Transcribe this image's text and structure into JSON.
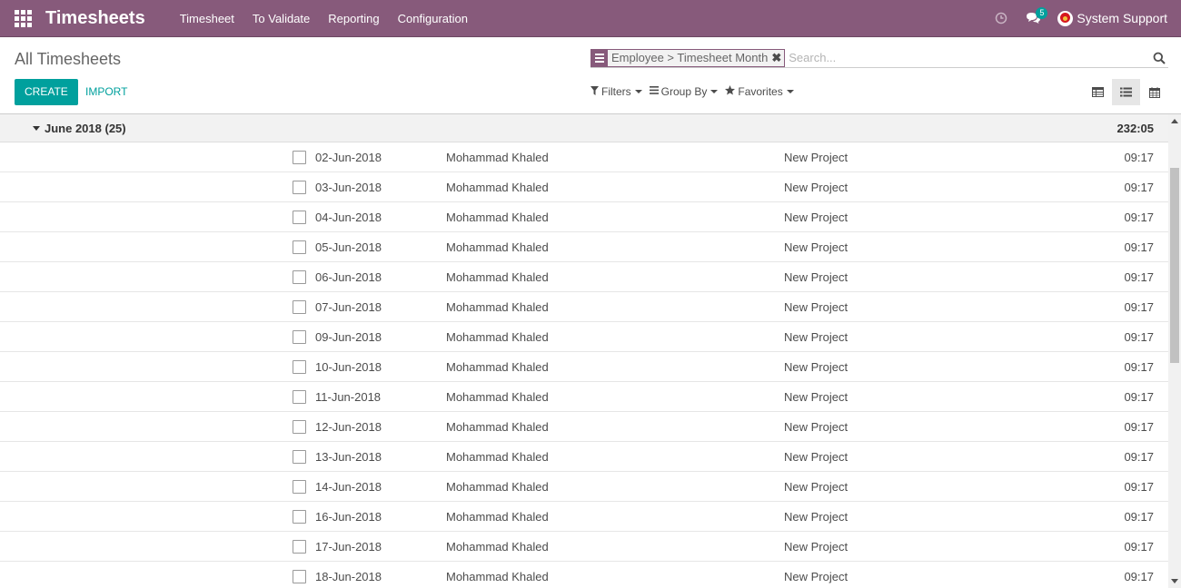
{
  "navbar": {
    "brand": "Timesheets",
    "menu": [
      "Timesheet",
      "To Validate",
      "Reporting",
      "Configuration"
    ],
    "message_count": "5",
    "user_name": "System Support"
  },
  "control_panel": {
    "breadcrumb": "All Timesheets",
    "create_label": "CREATE",
    "import_label": "IMPORT",
    "facet_label": "Employee > Timesheet Month",
    "search_placeholder": "Search...",
    "filters_label": "Filters",
    "group_by_label": "Group By",
    "favorites_label": "Favorites"
  },
  "group": {
    "label": "June 2018 (25)",
    "total": "232:05"
  },
  "rows": [
    {
      "date": "02-Jun-2018",
      "employee": "Mohammad Khaled",
      "project": "New Project",
      "duration": "09:17"
    },
    {
      "date": "03-Jun-2018",
      "employee": "Mohammad Khaled",
      "project": "New Project",
      "duration": "09:17"
    },
    {
      "date": "04-Jun-2018",
      "employee": "Mohammad Khaled",
      "project": "New Project",
      "duration": "09:17"
    },
    {
      "date": "05-Jun-2018",
      "employee": "Mohammad Khaled",
      "project": "New Project",
      "duration": "09:17"
    },
    {
      "date": "06-Jun-2018",
      "employee": "Mohammad Khaled",
      "project": "New Project",
      "duration": "09:17"
    },
    {
      "date": "07-Jun-2018",
      "employee": "Mohammad Khaled",
      "project": "New Project",
      "duration": "09:17"
    },
    {
      "date": "09-Jun-2018",
      "employee": "Mohammad Khaled",
      "project": "New Project",
      "duration": "09:17"
    },
    {
      "date": "10-Jun-2018",
      "employee": "Mohammad Khaled",
      "project": "New Project",
      "duration": "09:17"
    },
    {
      "date": "11-Jun-2018",
      "employee": "Mohammad Khaled",
      "project": "New Project",
      "duration": "09:17"
    },
    {
      "date": "12-Jun-2018",
      "employee": "Mohammad Khaled",
      "project": "New Project",
      "duration": "09:17"
    },
    {
      "date": "13-Jun-2018",
      "employee": "Mohammad Khaled",
      "project": "New Project",
      "duration": "09:17"
    },
    {
      "date": "14-Jun-2018",
      "employee": "Mohammad Khaled",
      "project": "New Project",
      "duration": "09:17"
    },
    {
      "date": "16-Jun-2018",
      "employee": "Mohammad Khaled",
      "project": "New Project",
      "duration": "09:17"
    },
    {
      "date": "17-Jun-2018",
      "employee": "Mohammad Khaled",
      "project": "New Project",
      "duration": "09:17"
    },
    {
      "date": "18-Jun-2018",
      "employee": "Mohammad Khaled",
      "project": "New Project",
      "duration": "09:17"
    }
  ]
}
